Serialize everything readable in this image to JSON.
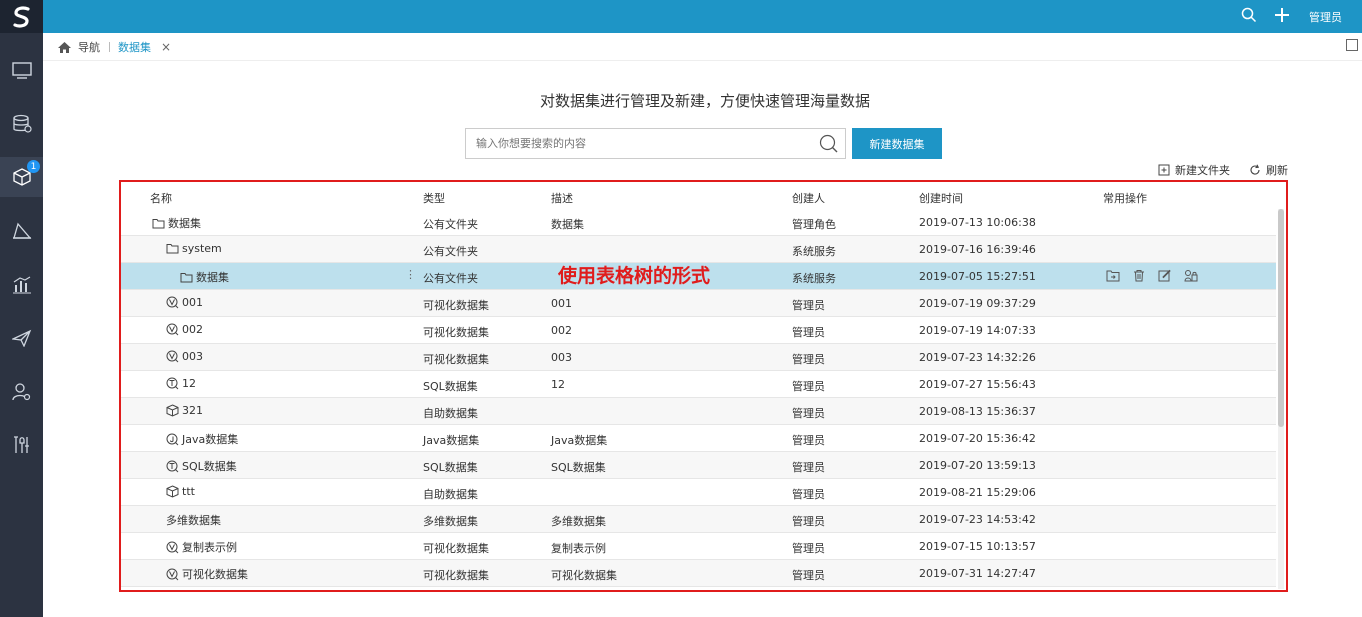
{
  "topbar": {
    "user_label": "管理员"
  },
  "tabs": {
    "home_label": "导航",
    "active_label": "数据集",
    "close_glyph": "×"
  },
  "main": {
    "title": "对数据集进行管理及新建，方便快速管理海量数据",
    "search_placeholder": "输入你想要搜索的内容",
    "new_button_label": "新建数据集",
    "new_folder_label": "新建文件夹",
    "refresh_label": "刷新",
    "overlay_note": "使用表格树的形式"
  },
  "sidebar": {
    "badge_count": "1"
  },
  "table": {
    "headers": {
      "name": "名称",
      "type": "类型",
      "desc": "描述",
      "creator": "创建人",
      "created": "创建时间",
      "ops": "常用操作"
    },
    "rows": [
      {
        "name": "数据集",
        "type": "公有文件夹",
        "desc": "数据集",
        "creator": "管理角色",
        "created": "2019-07-13 10:06:38",
        "icon": "folder-icon",
        "indent": 0
      },
      {
        "name": "system",
        "type": "公有文件夹",
        "desc": "",
        "creator": "系统服务",
        "created": "2019-07-16 16:39:46",
        "icon": "folder-icon",
        "indent": 1
      },
      {
        "name": "数据集",
        "type": "公有文件夹",
        "desc": "",
        "creator": "系统服务",
        "created": "2019-07-05 15:27:51",
        "icon": "folder-icon",
        "indent": 2
      },
      {
        "name": "001",
        "type": "可视化数据集",
        "desc": "001",
        "creator": "管理员",
        "created": "2019-07-19 09:37:29",
        "icon": "visual-dataset-icon",
        "indent": 1
      },
      {
        "name": "002",
        "type": "可视化数据集",
        "desc": "002",
        "creator": "管理员",
        "created": "2019-07-19 14:07:33",
        "icon": "visual-dataset-icon",
        "indent": 1
      },
      {
        "name": "003",
        "type": "可视化数据集",
        "desc": "003",
        "creator": "管理员",
        "created": "2019-07-23 14:32:26",
        "icon": "visual-dataset-icon",
        "indent": 1
      },
      {
        "name": "12",
        "type": "SQL数据集",
        "desc": "12",
        "creator": "管理员",
        "created": "2019-07-27 15:56:43",
        "icon": "sql-dataset-icon",
        "indent": 1
      },
      {
        "name": "321",
        "type": "自助数据集",
        "desc": "",
        "creator": "管理员",
        "created": "2019-08-13 15:36:37",
        "icon": "cube-icon",
        "indent": 1
      },
      {
        "name": "Java数据集",
        "type": "Java数据集",
        "desc": "Java数据集",
        "creator": "管理员",
        "created": "2019-07-20 15:36:42",
        "icon": "java-dataset-icon",
        "indent": 1
      },
      {
        "name": "SQL数据集",
        "type": "SQL数据集",
        "desc": "SQL数据集",
        "creator": "管理员",
        "created": "2019-07-20 13:59:13",
        "icon": "sql-dataset-icon",
        "indent": 1
      },
      {
        "name": "ttt",
        "type": "自助数据集",
        "desc": "",
        "creator": "管理员",
        "created": "2019-08-21 15:29:06",
        "icon": "cube-icon",
        "indent": 1
      },
      {
        "name": "多维数据集",
        "type": "多维数据集",
        "desc": "多维数据集",
        "creator": "管理员",
        "created": "2019-07-23 14:53:42",
        "icon": "",
        "indent": 1
      },
      {
        "name": "复制表示例",
        "type": "可视化数据集",
        "desc": "复制表示例",
        "creator": "管理员",
        "created": "2019-07-15 10:13:57",
        "icon": "visual-dataset-icon",
        "indent": 1
      },
      {
        "name": "可视化数据集",
        "type": "可视化数据集",
        "desc": "可视化数据集",
        "creator": "管理员",
        "created": "2019-07-31 14:27:47",
        "icon": "visual-dataset-icon",
        "indent": 1
      }
    ]
  }
}
